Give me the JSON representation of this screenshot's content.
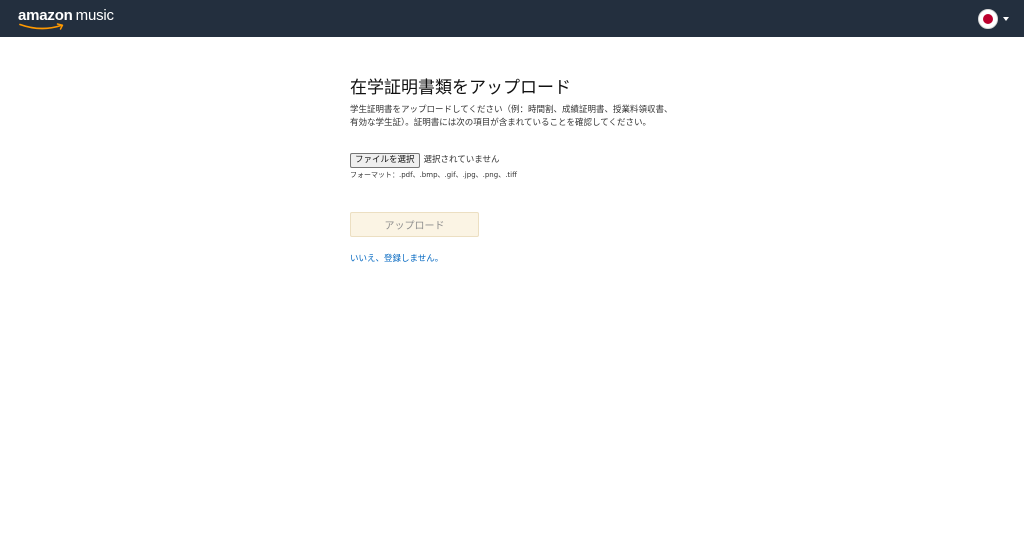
{
  "header": {
    "logo": {
      "brand": "amazon",
      "product": "music"
    },
    "locale": {
      "flag_icon": "japan-flag-icon",
      "flag_color": "#bc002d"
    },
    "colors": {
      "background": "#232f3e"
    }
  },
  "main": {
    "title": "在学証明書類をアップロード",
    "description": "学生証明書をアップロードしてください（例：時間割、成績証明書、授業料領収書、有効な学生証）。証明書には次の項目が含まれていることを確認してください。",
    "file_input": {
      "button_label": "ファイルを選択",
      "status": "選択されていません",
      "formats": "フォーマット：.pdf、.bmp、.gif、.jpg、.png、.tiff"
    },
    "upload_button": {
      "label": "アップロード"
    },
    "decline_link": "いいえ、登録しません。"
  }
}
